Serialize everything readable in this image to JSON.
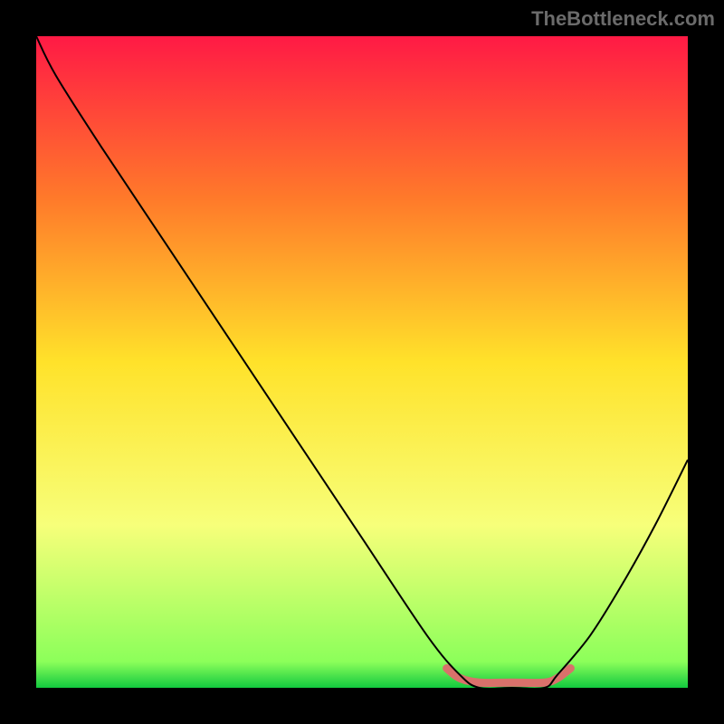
{
  "attribution": "TheBottleneck.com",
  "chart_data": {
    "type": "line",
    "title": "",
    "xlabel": "",
    "ylabel": "",
    "xlim": [
      0,
      100
    ],
    "ylim": [
      0,
      100
    ],
    "series": [
      {
        "name": "curve",
        "x": [
          0,
          3,
          10,
          20,
          30,
          40,
          50,
          60,
          65,
          68,
          73,
          78,
          80,
          85,
          90,
          95,
          100
        ],
        "values": [
          100,
          94,
          83,
          68,
          53,
          38,
          23,
          8,
          2,
          0,
          0,
          0,
          2,
          8,
          16,
          25,
          35
        ]
      }
    ],
    "highlight": {
      "color": "#d9716b",
      "x": [
        63,
        65,
        68,
        73,
        78,
        80,
        82
      ],
      "values": [
        3,
        1.5,
        0.8,
        0.8,
        0.8,
        1.5,
        3
      ]
    },
    "gradient_stops": [
      {
        "offset": 0,
        "color": "#ff1a45"
      },
      {
        "offset": 25,
        "color": "#ff7a2a"
      },
      {
        "offset": 50,
        "color": "#ffe22a"
      },
      {
        "offset": 75,
        "color": "#f7ff7a"
      },
      {
        "offset": 96,
        "color": "#8cff5a"
      },
      {
        "offset": 100,
        "color": "#12c93f"
      }
    ]
  }
}
